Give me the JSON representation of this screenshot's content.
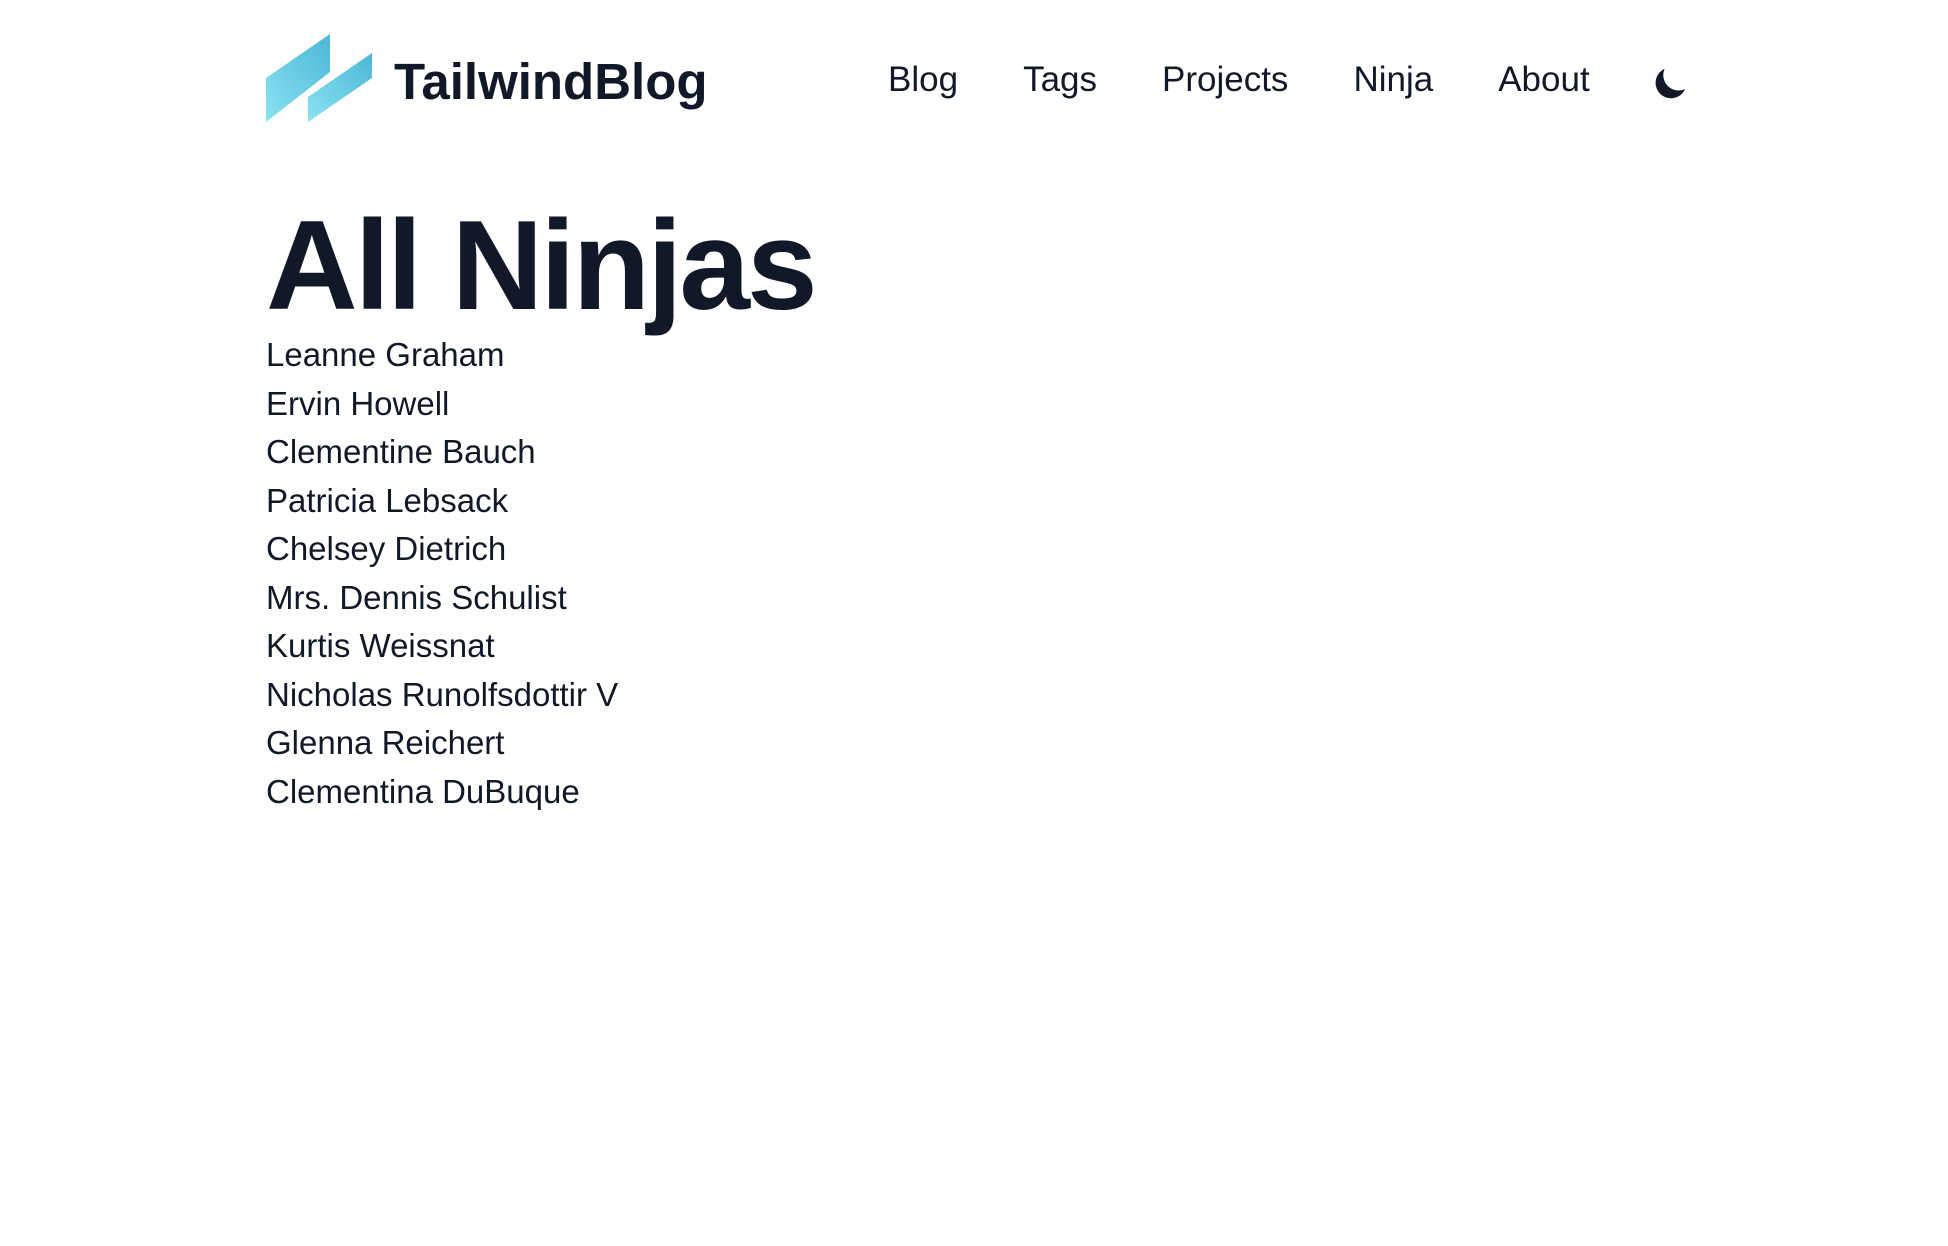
{
  "brand": {
    "name": "TailwindBlog",
    "logo_colors": [
      "#5ec8e8",
      "#8ae2f2",
      "#4db7d6"
    ]
  },
  "nav": {
    "items": [
      {
        "label": "Blog"
      },
      {
        "label": "Tags"
      },
      {
        "label": "Projects"
      },
      {
        "label": "Ninja"
      },
      {
        "label": "About"
      }
    ],
    "theme_toggle_icon": "moon-icon"
  },
  "main": {
    "title": "All Ninjas",
    "ninjas": [
      "Leanne Graham",
      "Ervin Howell",
      "Clementine Bauch",
      "Patricia Lebsack",
      "Chelsey Dietrich",
      "Mrs. Dennis Schulist",
      "Kurtis Weissnat",
      "Nicholas Runolfsdottir V",
      "Glenna Reichert",
      "Clementina DuBuque"
    ]
  },
  "colors": {
    "text": "#111827",
    "background": "#ffffff"
  }
}
